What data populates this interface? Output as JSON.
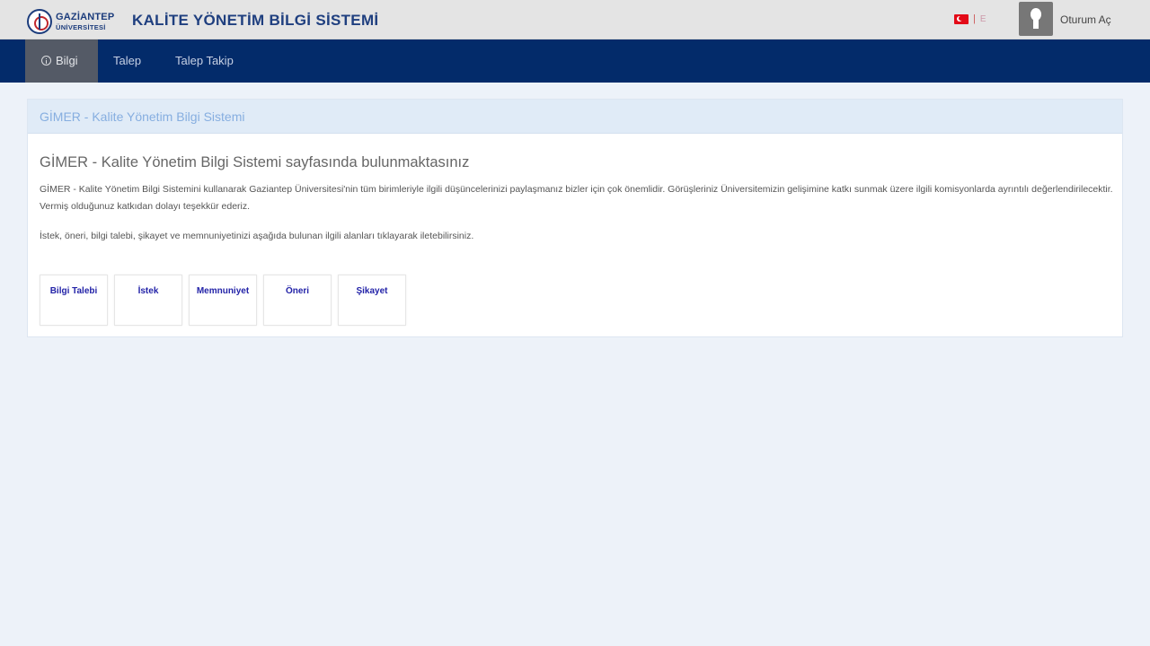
{
  "header": {
    "logo": {
      "line1": "GAZİANTEP",
      "line2": "ÜNİVERSİTESİ"
    },
    "title": "KALİTE YÖNETİM BİLGİ SİSTEMİ",
    "language": {
      "icon": "turkey-flag-icon",
      "separator": "|",
      "code": "E"
    },
    "user": {
      "avatar_icon": "user-icon",
      "login_label": "Oturum Aç"
    }
  },
  "nav": {
    "items": [
      {
        "label": "Bilgi",
        "icon": "info-icon",
        "active": true
      },
      {
        "label": "Talep",
        "active": false
      },
      {
        "label": "Talep Takip",
        "active": false
      }
    ]
  },
  "panel": {
    "heading": "GİMER - Kalite Yönetim Bilgi Sistemi",
    "page_heading": "GİMER - Kalite Yönetim Bilgi Sistemi sayfasında bulunmaktasınız",
    "intro": "GİMER - Kalite Yönetim Bilgi Sistemini kullanarak Gaziantep Üniversitesi'nin tüm birimleriyle ilgili düşüncelerinizi paylaşmanız bizler için çok önemlidir. Görüşleriniz Üniversitemizin gelişimine katkı sunmak üzere ilgili komisyonlarda ayrıntılı değerlendirilecektir. Vermiş olduğunuz katkıdan dolayı teşekkür ederiz.",
    "prompt": "İstek, öneri, bilgi talebi, şikayet ve memnuniyetinizi aşağıda bulunan ilgili alanları tıklayarak iletebilirsiniz.",
    "tiles": [
      "Bilgi Talebi",
      "İstek",
      "Memnuniyet",
      "Öneri",
      "Şikayet"
    ]
  },
  "colors": {
    "topbar_bg": "#e4e4e4",
    "nav_bg": "#032b6a",
    "nav_active_bg": "#545a66",
    "page_bg": "#edf2f9",
    "panel_heading_bg": "#e0ebf7",
    "tile_text": "#2323a8"
  }
}
